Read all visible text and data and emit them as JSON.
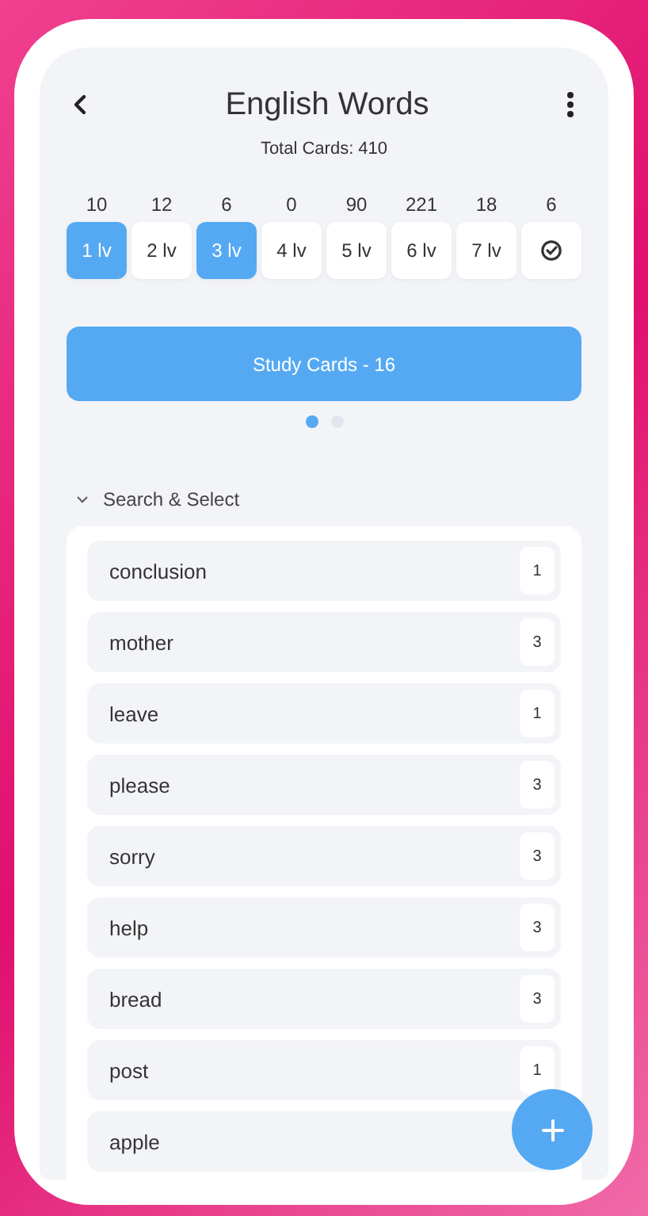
{
  "header": {
    "title": "English Words",
    "subtitle": "Total Cards: 410"
  },
  "levels": [
    {
      "kind": "level",
      "count": "10",
      "label": "1 lv",
      "selected": true
    },
    {
      "kind": "level",
      "count": "12",
      "label": "2 lv",
      "selected": false
    },
    {
      "kind": "level",
      "count": "6",
      "label": "3 lv",
      "selected": true
    },
    {
      "kind": "level",
      "count": "0",
      "label": "4 lv",
      "selected": false
    },
    {
      "kind": "level",
      "count": "90",
      "label": "5 lv",
      "selected": false
    },
    {
      "kind": "level",
      "count": "221",
      "label": "6 lv",
      "selected": false
    },
    {
      "kind": "level",
      "count": "18",
      "label": "7 lv",
      "selected": false
    },
    {
      "kind": "check",
      "count": "6",
      "selected": false
    }
  ],
  "study_button": "Study Cards - 16",
  "pager": [
    {
      "selected": true
    },
    {
      "selected": false
    }
  ],
  "section": {
    "title": "Search & Select",
    "expanded": true
  },
  "words": [
    {
      "word": "conclusion",
      "count": "1"
    },
    {
      "word": "mother",
      "count": "3"
    },
    {
      "word": "leave",
      "count": "1"
    },
    {
      "word": "please",
      "count": "3"
    },
    {
      "word": "sorry",
      "count": "3"
    },
    {
      "word": "help",
      "count": "3"
    },
    {
      "word": "bread",
      "count": "3"
    },
    {
      "word": "post",
      "count": "1"
    },
    {
      "word": "apple"
    }
  ]
}
